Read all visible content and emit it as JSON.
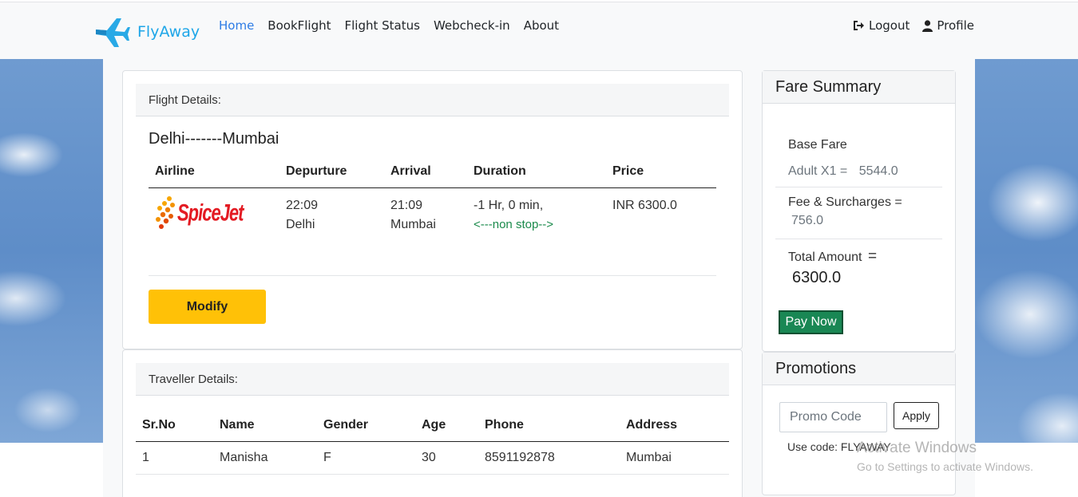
{
  "navbar": {
    "brand": "FlyAway",
    "links": [
      "Home",
      "BookFlight",
      "Flight Status",
      "Webcheck-in",
      "About"
    ],
    "logout": "Logout",
    "profile": "Profile"
  },
  "flight_details": {
    "header": "Flight Details:",
    "route": "Delhi-------Mumbai",
    "columns": [
      "Airline",
      "Depurture",
      "Arrival",
      "Duration",
      "Price"
    ],
    "airline_logo_text": "SpiceJet",
    "departure_time": "22:09",
    "departure_city": "Delhi",
    "arrival_time": "21:09",
    "arrival_city": "Mumbai",
    "duration": "-1 Hr, 0 min,",
    "stops": "<---non stop-->",
    "price": "INR 6300.0",
    "modify_label": "Modify"
  },
  "traveller_details": {
    "header": "Traveller Details:",
    "columns": [
      "Sr.No",
      "Name",
      "Gender",
      "Age",
      "Phone",
      "Address"
    ],
    "rows": [
      [
        "1",
        "Manisha",
        "F",
        "30",
        "8591192878",
        "Mumbai"
      ]
    ]
  },
  "fare_summary": {
    "title": "Fare Summary",
    "base_fare_label": "Base Fare",
    "adult_label": "Adult X1 =",
    "adult_value": "5544.0",
    "fee_label": "Fee & Surcharges =",
    "fee_value": "756.0",
    "total_label": "Total Amount",
    "total_eq": "=",
    "total_value": "6300.0",
    "pay_label": "Pay Now"
  },
  "promotions": {
    "title": "Promotions",
    "placeholder": "Promo Code",
    "apply_label": "Apply",
    "note": "Use code: FLYAWAY"
  },
  "watermark": {
    "line1": "Activate Windows",
    "line2": "Go to Settings to activate Windows."
  },
  "colors": {
    "brand": "#1ea6e8",
    "active_link": "#2c7be5",
    "modify": "#ffc107",
    "pay": "#198754",
    "nonstop": "#1a8a4b",
    "logo_red": "#e31b23"
  }
}
